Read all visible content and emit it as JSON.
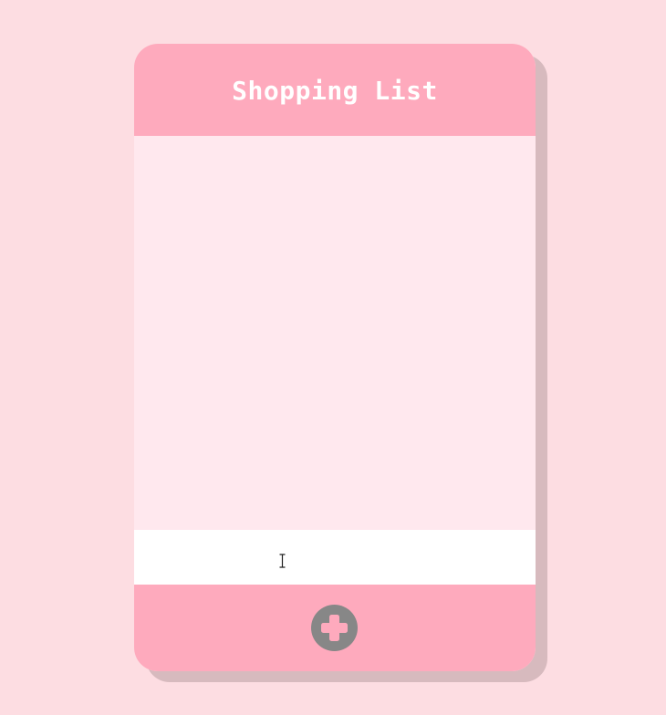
{
  "app": {
    "title": "Shopping List"
  },
  "list": {
    "items": []
  },
  "input": {
    "value": "",
    "placeholder": ""
  },
  "footer": {
    "add_icon": "plus-circle-icon"
  },
  "colors": {
    "background": "#fddde2",
    "header": "#feaabd",
    "list_background": "#ffe8ee",
    "input_background": "#ffffff",
    "add_button": "#878787"
  }
}
